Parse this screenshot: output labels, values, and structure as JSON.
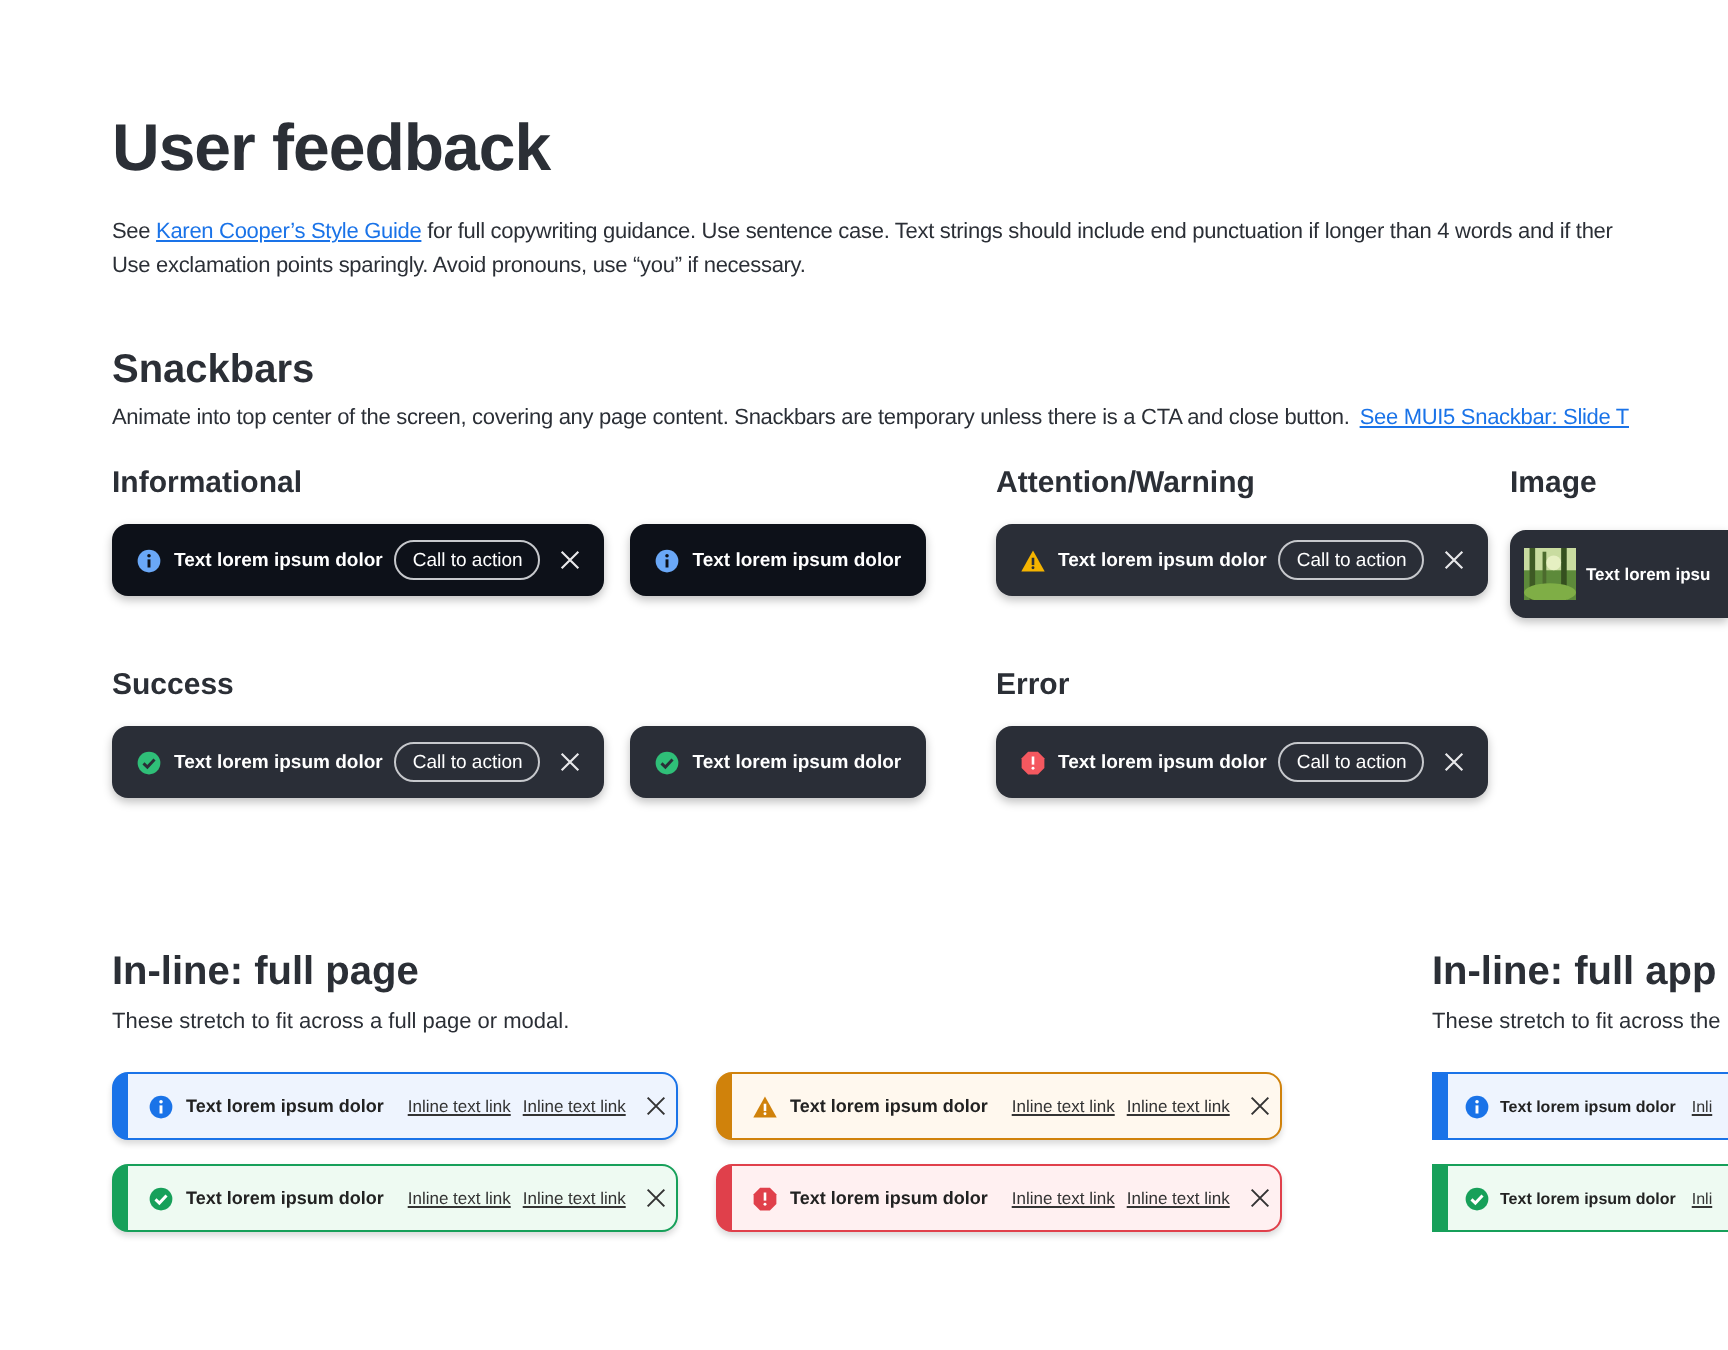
{
  "title": "User feedback",
  "intro": {
    "before": "See ",
    "link": "Karen Cooper’s Style Guide",
    "after": " for full copywriting guidance. Use sentence case. Text strings should include end punctuation if longer than 4 words and if ther",
    "line2": "Use exclamation points sparingly. Avoid pronouns, use “you” if necessary."
  },
  "snackbars": {
    "title": "Snackbars",
    "description": "Animate into top center of the screen, covering any page content. Snackbars are temporary unless there is a CTA and close button.",
    "link": "See MUI5 Snackbar: Slide T",
    "groups": [
      {
        "title": "Informational",
        "items": [
          {
            "kind": "info",
            "text": "Text lorem ipsum dolor",
            "cta": "Call to action",
            "closable": true
          },
          {
            "kind": "info",
            "text": "Text lorem ipsum dolor",
            "closable": false
          }
        ]
      },
      {
        "title": "Attention/Warning",
        "items": [
          {
            "kind": "warning",
            "text": "Text lorem ipsum dolor",
            "cta": "Call to action",
            "closable": true
          }
        ]
      },
      {
        "title": "Image",
        "items": [
          {
            "text": "Text lorem ipsu",
            "closable": false
          }
        ]
      },
      {
        "title": "Success",
        "items": [
          {
            "kind": "success",
            "text": "Text lorem ipsum dolor",
            "cta": "Call to action",
            "closable": true
          },
          {
            "kind": "success",
            "text": "Text lorem ipsum dolor",
            "closable": false
          }
        ]
      },
      {
        "title": "Error",
        "items": [
          {
            "kind": "error",
            "text": "Text lorem ipsum dolor",
            "cta": "Call to action",
            "closable": true
          }
        ]
      }
    ]
  },
  "inline_sections": [
    {
      "title": "In-line: full page",
      "description": "These stretch to fit across a full page or modal.",
      "items": [
        {
          "kind": "info",
          "text": "Text lorem ipsum dolor",
          "links": [
            "Inline text link",
            "Inline text link"
          ],
          "closable": true
        },
        {
          "kind": "warning",
          "text": "Text lorem ipsum dolor",
          "links": [
            "Inline text link",
            "Inline text link"
          ],
          "closable": true
        },
        {
          "kind": "success",
          "text": "Text lorem ipsum dolor",
          "links": [
            "Inline text link",
            "Inline text link"
          ],
          "closable": true
        },
        {
          "kind": "error",
          "text": "Text lorem ipsum dolor",
          "links": [
            "Inline text link",
            "Inline text link"
          ],
          "closable": true
        }
      ]
    },
    {
      "title": "In-line: full app",
      "description": "These stretch to fit across the",
      "items": [
        {
          "kind": "info",
          "text": "Text lorem ipsum dolor",
          "links": [
            "Inli"
          ],
          "closable": false
        },
        {
          "kind": "success",
          "text": "Text lorem ipsum dolor",
          "links": [
            "Inli"
          ],
          "closable": false
        }
      ]
    }
  ]
}
